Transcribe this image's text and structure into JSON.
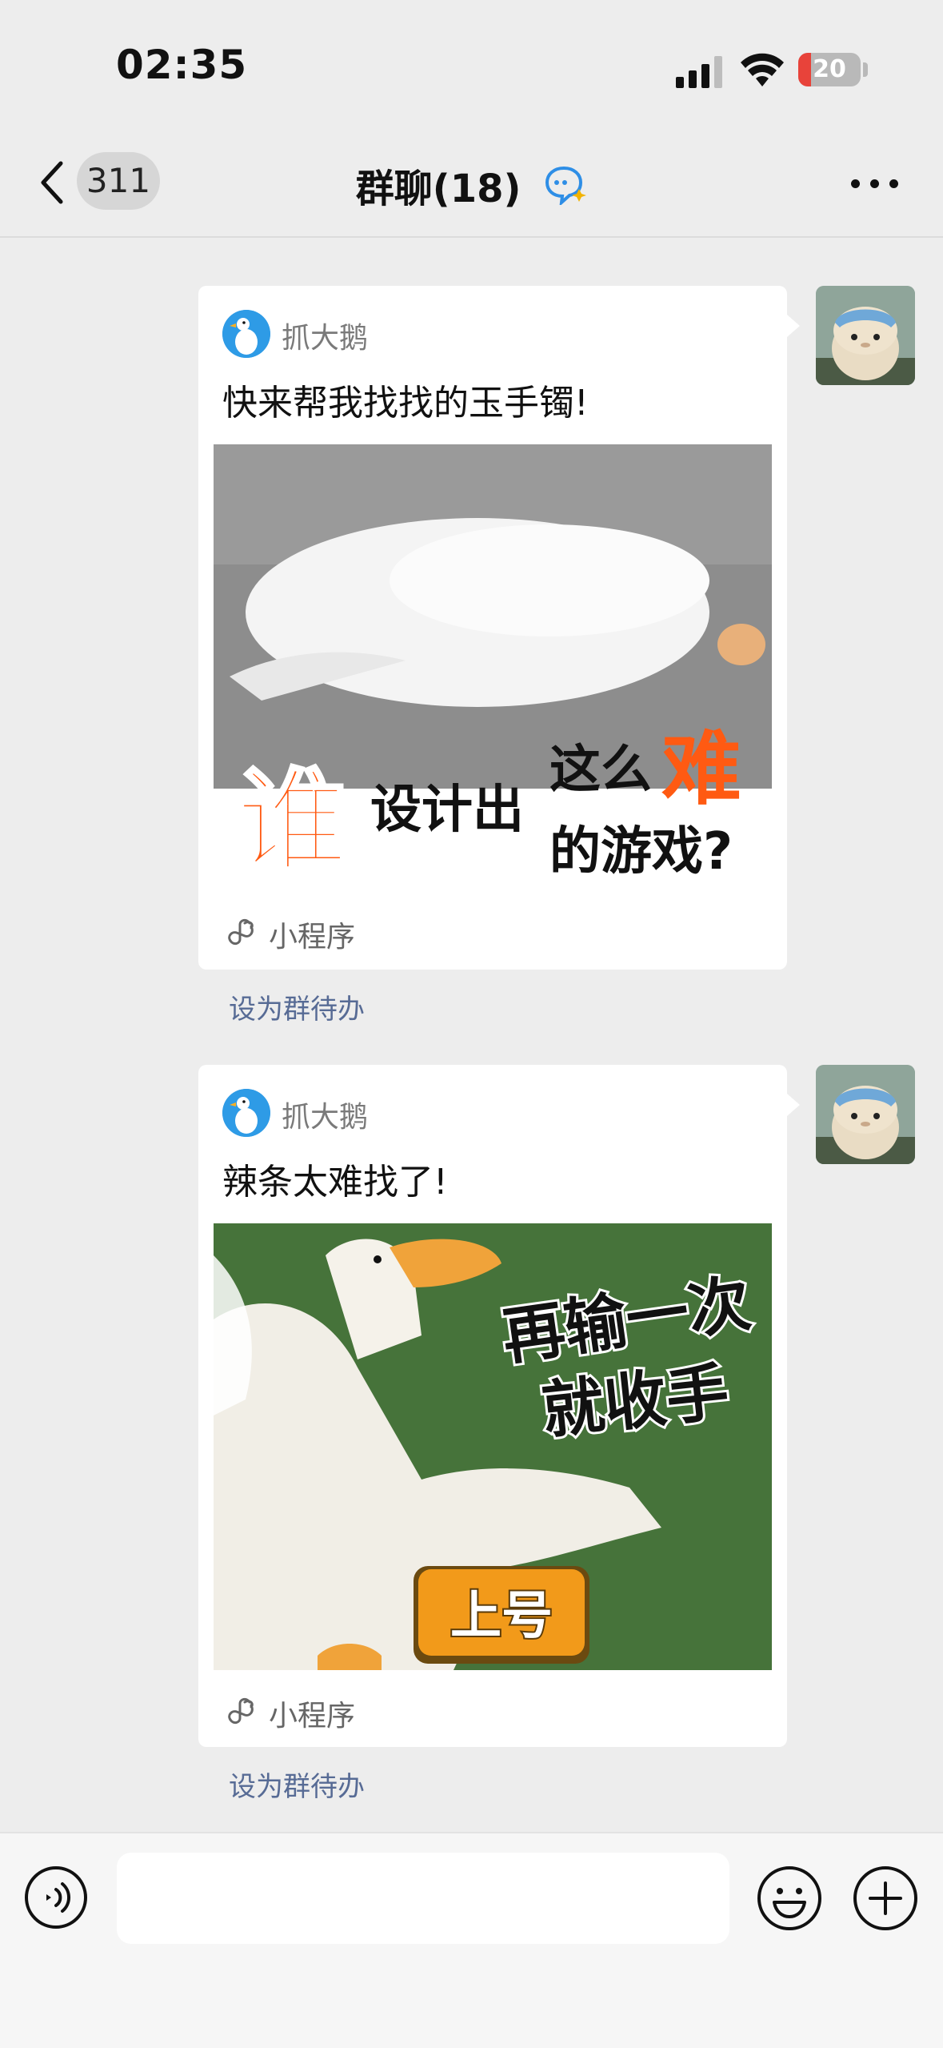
{
  "status_bar": {
    "time": "02:35",
    "battery": "20",
    "battery_level": 0.2
  },
  "nav": {
    "unread_count": "311",
    "title": "群聊(18)"
  },
  "messages": [
    {
      "app_name": "抓大鹅",
      "text": "快来帮我找找的玉手镯!",
      "image_caption_line1": "谁",
      "image_caption_line2": "设计出",
      "image_caption_line3": "这么",
      "image_caption_line4": "难",
      "image_caption_line5": "的游戏?",
      "footer_label": "小程序",
      "todo_label": "设为群待办"
    },
    {
      "app_name": "抓大鹅",
      "text": "辣条太难找了!",
      "image_caption_line1": "再输一次",
      "image_caption_line2": "就收手",
      "image_button_label": "上号",
      "footer_label": "小程序",
      "todo_label": "设为群待办"
    }
  ],
  "input_bar": {
    "placeholder": ""
  },
  "colors": {
    "background": "#ededed",
    "link_blue": "#576b95",
    "accent_orange": "#ff5a12",
    "battery_red": "#e8433a"
  },
  "icons": [
    "chevron-left-icon",
    "chat-ai-icon",
    "more-icon",
    "mini-program-link-icon",
    "voice-icon",
    "emoji-icon",
    "plus-icon",
    "signal-icon",
    "wifi-icon",
    "battery-icon"
  ]
}
